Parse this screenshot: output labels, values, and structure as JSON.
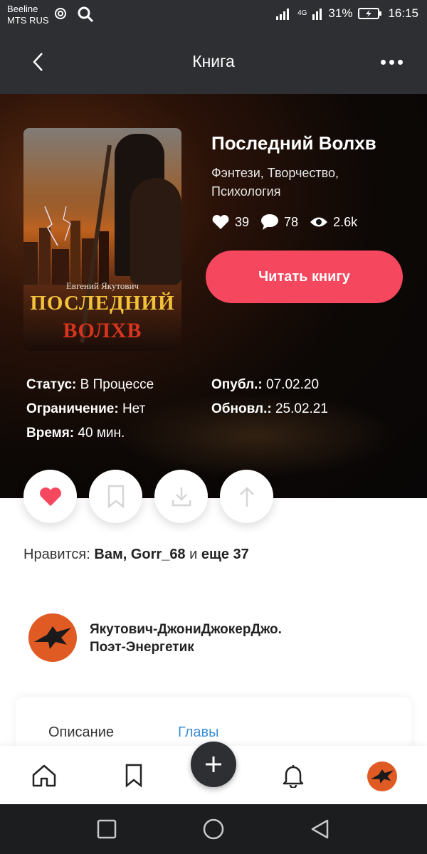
{
  "status_bar": {
    "carrier_line1": "Beeline",
    "carrier_line2": "MTS RUS",
    "network": "4G",
    "battery": "31%",
    "time": "16:15"
  },
  "header": {
    "title": "Книга",
    "back_icon": "chevron-left-icon",
    "more_icon": "more-dots-icon"
  },
  "book": {
    "title": "Последний Волхв",
    "genres": "Фэнтези, Творчество, Психология",
    "cover": {
      "author": "Евгений Якутович",
      "title_line1": "ПОСЛЕДНИЙ",
      "title_line2": "ВОЛХВ"
    },
    "stats": {
      "likes": "39",
      "comments": "78",
      "views": "2.6k"
    },
    "read_button": "Читать книгу"
  },
  "info": {
    "status_label": "Статус:",
    "status_value": "В Процессе",
    "restriction_label": "Ограничение:",
    "restriction_value": "Нет",
    "time_label": "Время:",
    "time_value": "40 мин.",
    "published_label": "Опубл.:",
    "published_value": "07.02.20",
    "updated_label": "Обновл.:",
    "updated_value": "25.02.21"
  },
  "likes_line": {
    "prefix": "Нравится:",
    "names": "Вам, Gorr_68",
    "conj": "и",
    "rest": "еще 37"
  },
  "author": {
    "name_line1": "Якутович-ДжониДжокерДжо.",
    "name_line2": "Поэт-Энергетик"
  },
  "tabs": {
    "description": "Описание",
    "chapters": "Главы"
  },
  "colors": {
    "accent": "#f5475e",
    "dark": "#2d2f32",
    "link": "#3b8fd4"
  }
}
